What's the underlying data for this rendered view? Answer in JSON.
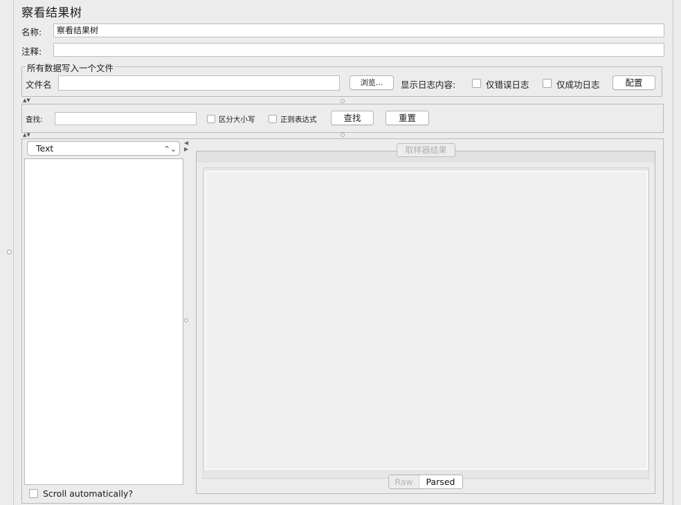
{
  "page_title": "察看结果树",
  "form": {
    "name_label": "名称:",
    "name_value": "察看结果树",
    "comment_label": "注释:",
    "comment_value": ""
  },
  "file_group": {
    "title": "所有数据写入一个文件",
    "filename_label": "文件名",
    "filename_value": "",
    "browse_label": "浏览...",
    "log_content_label": "显示日志内容:",
    "errors_only_label": "仅错误日志",
    "success_only_label": "仅成功日志",
    "configure_label": "配置"
  },
  "search": {
    "label": "查找:",
    "value": "",
    "case_sensitive_label": "区分大小写",
    "regex_label": "正则表达式",
    "find_label": "查找",
    "reset_label": "重置"
  },
  "results": {
    "renderer_selected": "Text",
    "scroll_auto_label": "Scroll automatically?",
    "sampler_result_label": "取样器结果",
    "view_tabs": [
      "Raw",
      "Parsed"
    ]
  }
}
